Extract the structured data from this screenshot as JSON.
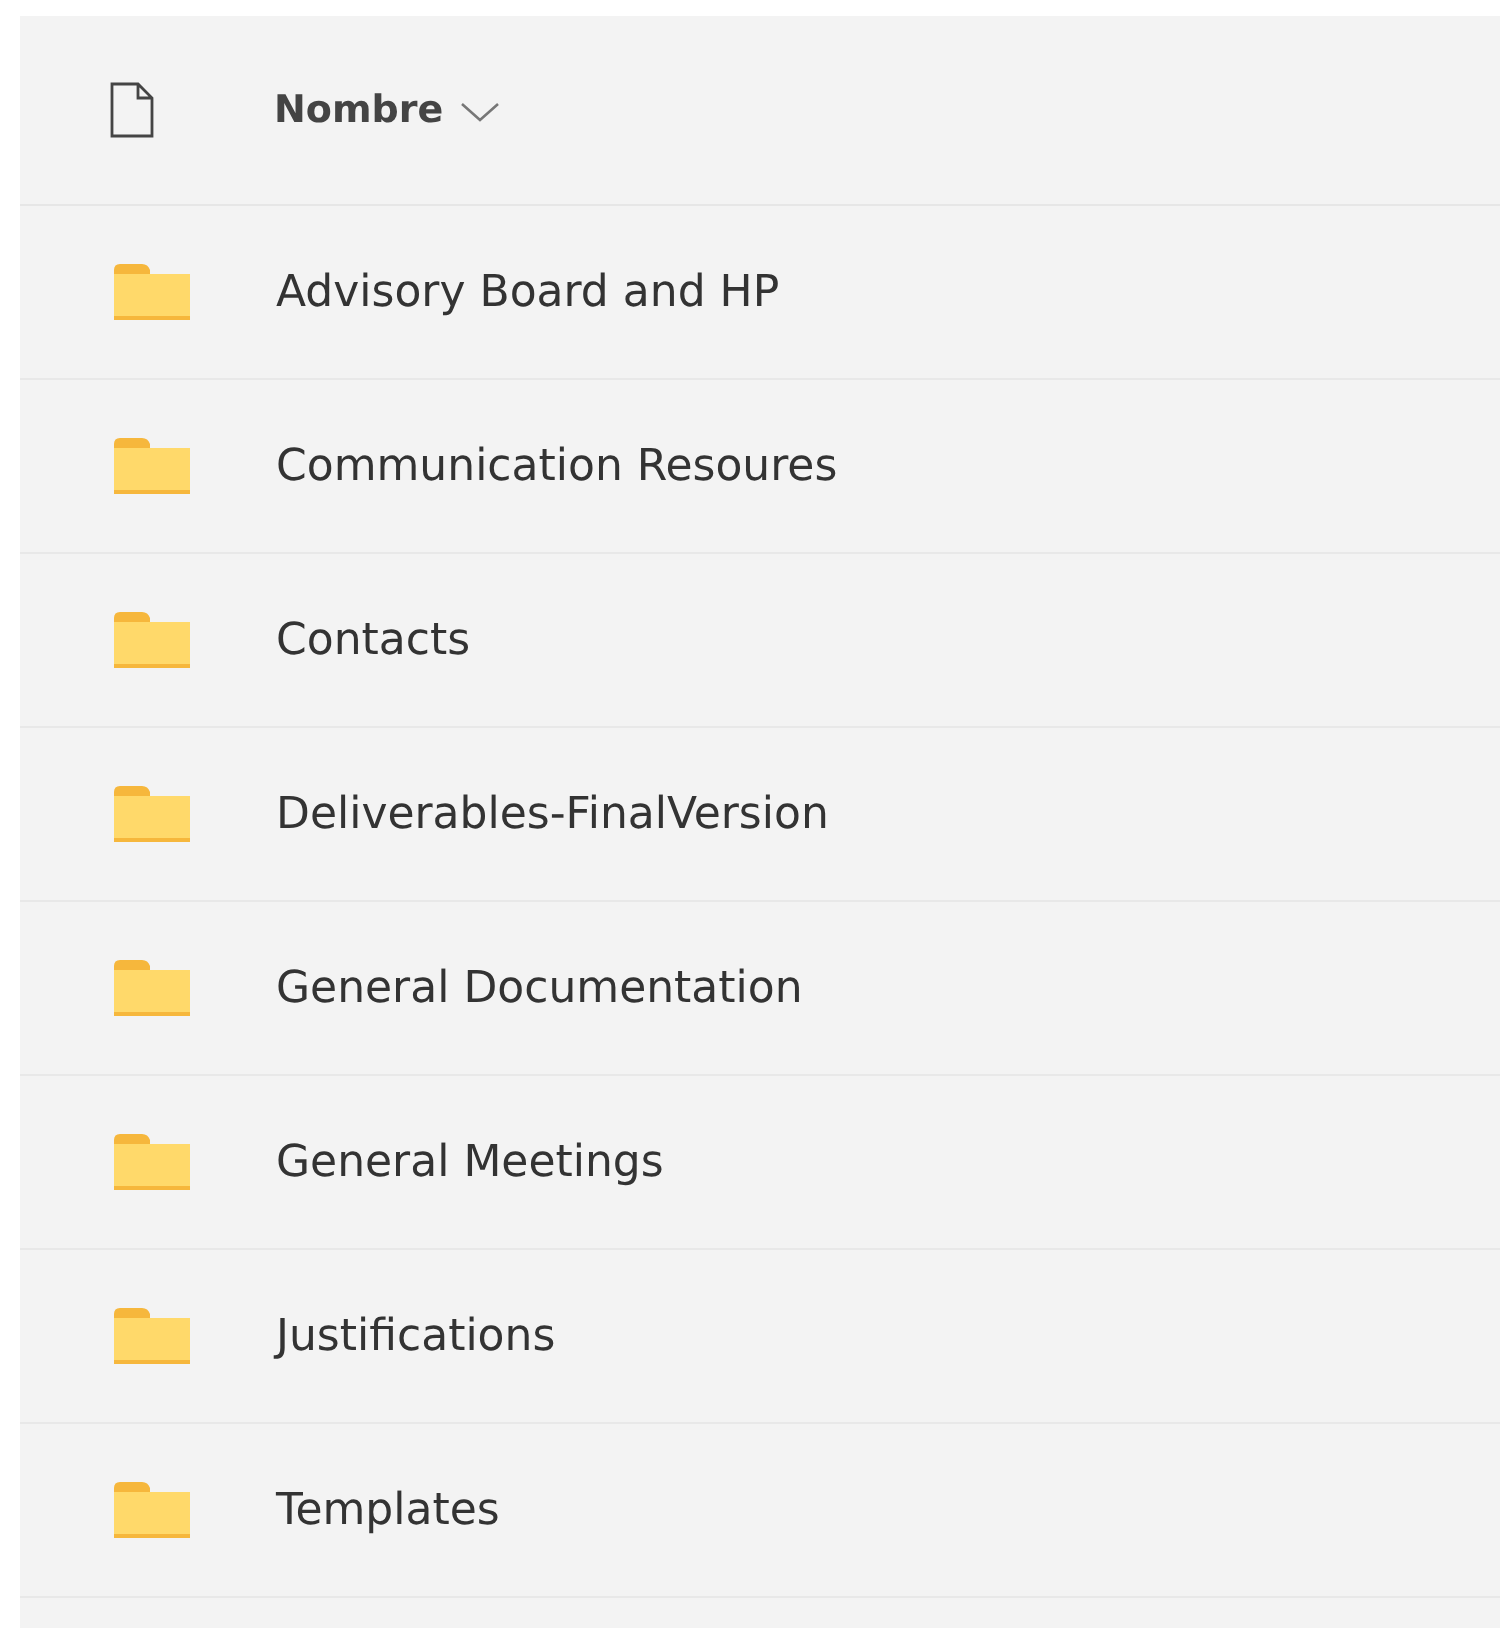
{
  "header": {
    "column_label": "Nombre"
  },
  "rows": [
    {
      "name": "Advisory Board and HP"
    },
    {
      "name": "Communication Resoures"
    },
    {
      "name": "Contacts"
    },
    {
      "name": "Deliverables-FinalVersion"
    },
    {
      "name": "General Documentation"
    },
    {
      "name": "General Meetings"
    },
    {
      "name": "Justifications"
    },
    {
      "name": "Templates"
    }
  ]
}
